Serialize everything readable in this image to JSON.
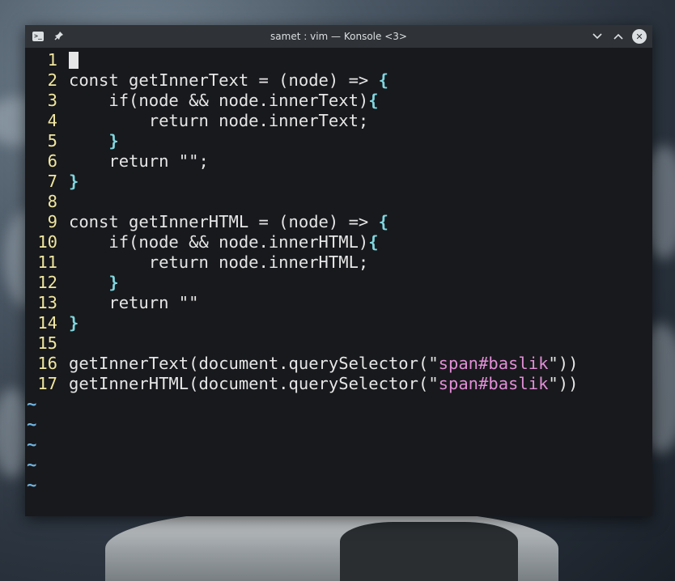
{
  "window": {
    "title": "samet : vim — Konsole <3>",
    "icons": {
      "app": "terminal-icon",
      "pin": "pin-icon",
      "minimize": "chevron-down-icon",
      "maximize": "chevron-up-icon",
      "close": "close-icon"
    }
  },
  "colors": {
    "background": "#1d1f21",
    "titlebar": "#2f3236",
    "line_number": "#f0e6a0",
    "brace": "#7fd7e0",
    "string": "#e28ed8",
    "tilde": "#6fb3e0",
    "text": "#e6e6e6"
  },
  "editor": {
    "lines": [
      {
        "num": "1",
        "text": ""
      },
      {
        "num": "2",
        "pre": "const getInnerText = (node) => ",
        "brace": "{"
      },
      {
        "num": "3",
        "pre": "    if(node && node.innerText)",
        "brace": "{"
      },
      {
        "num": "4",
        "pre": "        return node.innerText;"
      },
      {
        "num": "5",
        "pre": "    ",
        "brace": "}"
      },
      {
        "num": "6",
        "pre": "    return \"\";"
      },
      {
        "num": "7",
        "pre": "",
        "brace": "}"
      },
      {
        "num": "8",
        "pre": ""
      },
      {
        "num": "9",
        "pre": "const getInnerHTML = (node) => ",
        "brace": "{"
      },
      {
        "num": "10",
        "pre": "    if(node && node.innerHTML)",
        "brace": "{"
      },
      {
        "num": "11",
        "pre": "        return node.innerHTML;"
      },
      {
        "num": "12",
        "pre": "    ",
        "brace": "}"
      },
      {
        "num": "13",
        "pre": "    return \"\""
      },
      {
        "num": "14",
        "pre": "",
        "brace": "}"
      },
      {
        "num": "15",
        "pre": ""
      },
      {
        "num": "16",
        "pre": "getInnerText(document.querySelector(\"",
        "str": "span#baslik",
        "post": "\"))"
      },
      {
        "num": "17",
        "pre": "getInnerHTML(document.querySelector(\"",
        "str": "span#baslik",
        "post": "\"))"
      }
    ],
    "tildes": [
      "~",
      "~",
      "~",
      "~",
      "~"
    ]
  }
}
